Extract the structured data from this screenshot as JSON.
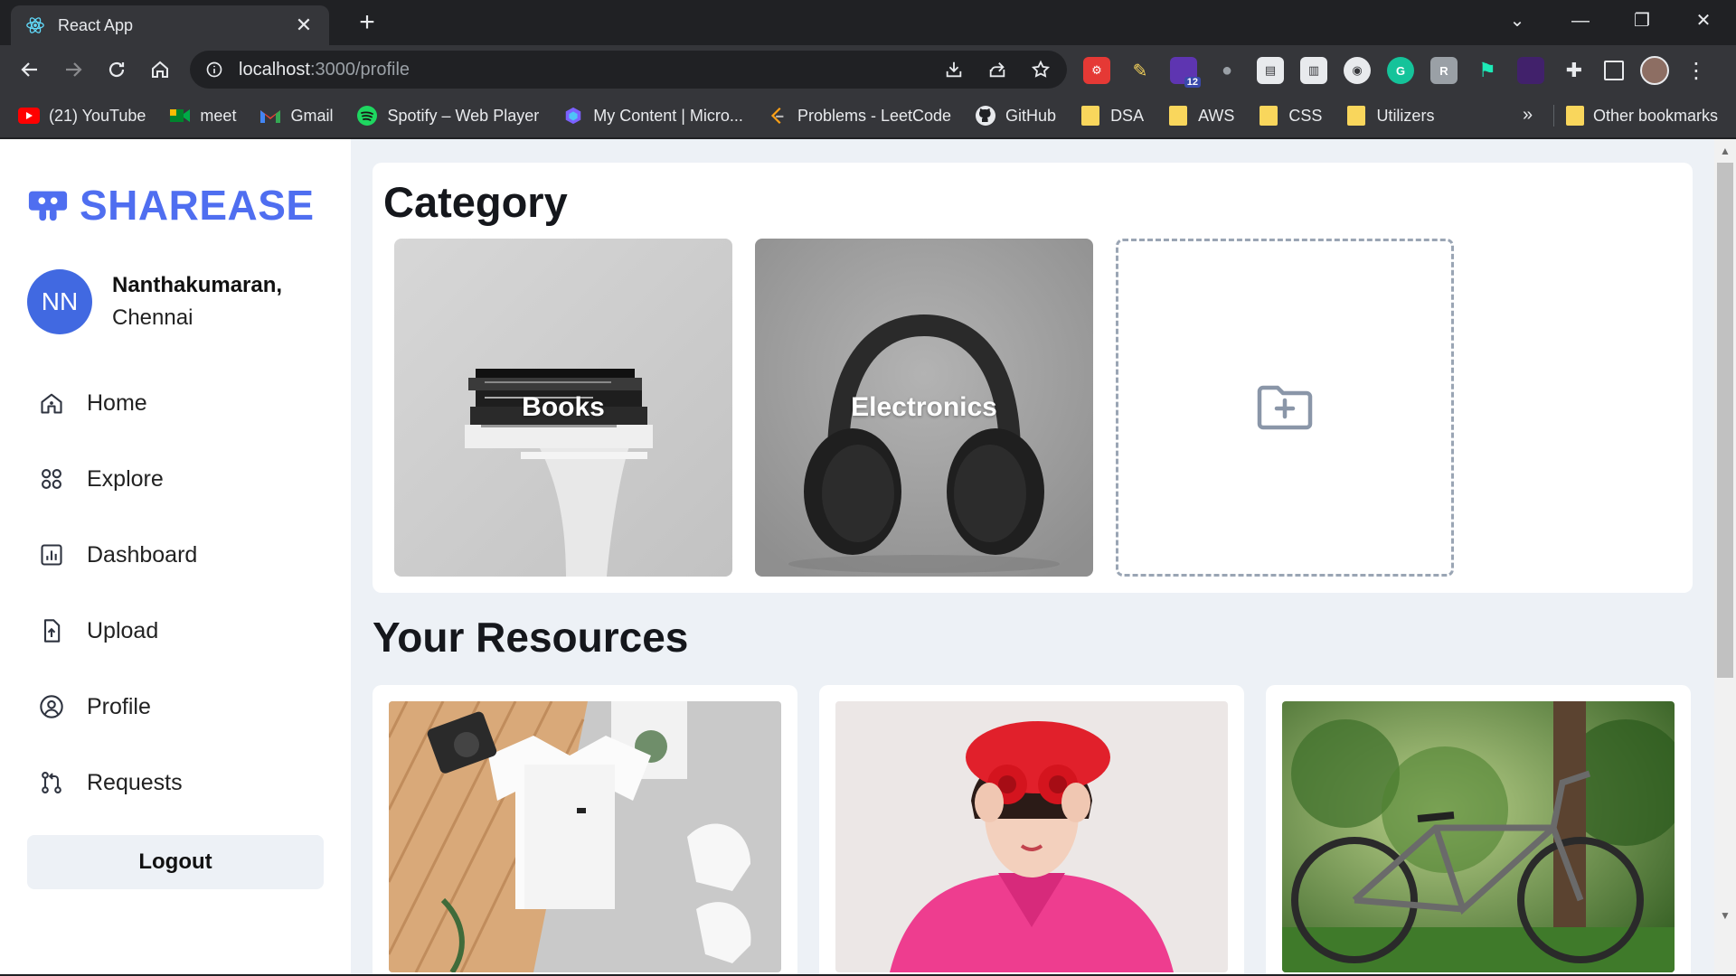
{
  "browser": {
    "tab_title": "React App",
    "tab_close": "✕",
    "new_tab": "+",
    "url_host": "localhost",
    "url_path": ":3000/profile",
    "extension_badge": "12",
    "window_controls": {
      "minimize": "—",
      "restore": "❐",
      "close": "✕",
      "tab_search": "⌄"
    },
    "bookmarks": [
      {
        "label": "(21) YouTube",
        "icon": "youtube-icon"
      },
      {
        "label": "meet",
        "icon": "meet-icon"
      },
      {
        "label": "Gmail",
        "icon": "gmail-icon"
      },
      {
        "label": "Spotify – Web Player",
        "icon": "spotify-icon"
      },
      {
        "label": "My Content | Micro...",
        "icon": "microsoft-icon"
      },
      {
        "label": "Problems - LeetCode",
        "icon": "leetcode-icon"
      },
      {
        "label": "GitHub",
        "icon": "github-icon"
      },
      {
        "label": "DSA",
        "icon": "folder-icon"
      },
      {
        "label": "AWS",
        "icon": "folder-icon"
      },
      {
        "label": "CSS",
        "icon": "folder-icon"
      },
      {
        "label": "Utilizers",
        "icon": "folder-icon"
      }
    ],
    "bookmarks_more": "»",
    "other_bookmarks": "Other bookmarks"
  },
  "sidebar": {
    "brand": "SHAREASE",
    "user_initials": "NN",
    "user_name": "Nanthakumaran,",
    "user_city": "Chennai",
    "nav": [
      {
        "label": "Home",
        "icon": "home-icon"
      },
      {
        "label": "Explore",
        "icon": "explore-icon"
      },
      {
        "label": "Dashboard",
        "icon": "dashboard-icon"
      },
      {
        "label": "Upload",
        "icon": "upload-icon"
      },
      {
        "label": "Profile",
        "icon": "profile-icon"
      },
      {
        "label": "Requests",
        "icon": "requests-icon"
      }
    ],
    "logout_label": "Logout"
  },
  "main": {
    "category_title": "Category",
    "categories": [
      {
        "label": "Books"
      },
      {
        "label": "Electronics"
      }
    ],
    "resources_title": "Your Resources",
    "resources": [
      {
        "image": "tshirt-flatlay"
      },
      {
        "image": "woman-red-roses"
      },
      {
        "image": "bicycle-park"
      }
    ]
  },
  "colors": {
    "brand": "#4f6ef0",
    "avatar": "#4169e1",
    "page_bg": "#edf1f6"
  }
}
